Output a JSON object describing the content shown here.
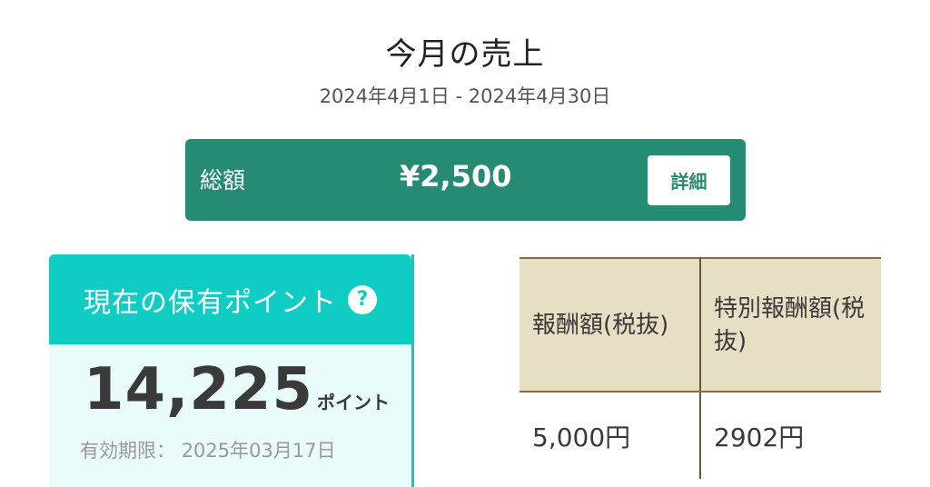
{
  "header": {
    "title": "今月の売上",
    "date_range": "2024年4月1日 - 2024年4月30日"
  },
  "total": {
    "label": "総額",
    "amount": "¥2,500",
    "detail_button": "詳細"
  },
  "points": {
    "heading": "現在の保有ポイント",
    "help_icon": "?",
    "value": "14,225",
    "unit": "ポイント",
    "expiry_label": "有効期限：",
    "expiry_date": "2025年03月17日"
  },
  "reward_table": {
    "headers": [
      "報酬額(税抜)",
      "特別報酬額(税抜)"
    ],
    "rows": [
      [
        "5,000円",
        "2902円"
      ]
    ]
  },
  "colors": {
    "total_bar": "#268b73",
    "points_header": "#10cdc4",
    "points_body": "#e9fbfb",
    "table_header": "#e7dfc4"
  }
}
